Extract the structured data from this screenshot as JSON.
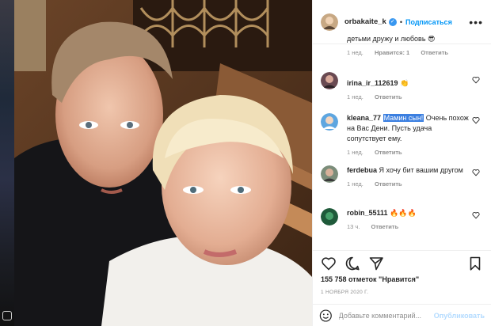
{
  "header": {
    "username": "orbakaite_k",
    "separator": "•",
    "follow_label": "Подписаться",
    "more_label": "•••"
  },
  "comments": [
    {
      "username": "",
      "text": "детьми дружу и любовь",
      "emoji": "😎",
      "time": "1 нед.",
      "likes": "Нравится: 1",
      "reply": "Ответить"
    },
    {
      "username": "irina_ir_112619",
      "text": "",
      "emoji": "👏",
      "time": "1 нед.",
      "reply": "Ответить"
    },
    {
      "username": "kleana_77",
      "highlight": "Мамин сын!",
      "text": " Очень похож на Вас Дени. Пусть удача сопутствует ему.",
      "time": "1 нед.",
      "reply": "Ответить"
    },
    {
      "username": "ferdebua",
      "text": "Я хочу бит вашим другом",
      "time": "1 нед.",
      "reply": "Ответить"
    },
    {
      "username": "robin_55111",
      "text": "",
      "emoji": "🔥🔥🔥",
      "time": "13 ч.",
      "reply": "Ответить"
    }
  ],
  "likes_text": "155 758 отметок \"Нравится\"",
  "date_text": "1 НОЯБРЯ 2020 Г.",
  "comment_box": {
    "placeholder": "Добавьте комментарий...",
    "publish_label": "Опубликовать"
  },
  "colors": {
    "accent": "#0095f6",
    "highlight": "#3b7fe0",
    "muted": "#8e8e8e"
  }
}
